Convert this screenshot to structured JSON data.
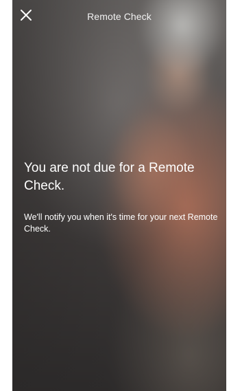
{
  "header": {
    "title": "Remote Check",
    "close_icon": "close-icon"
  },
  "message": {
    "headline": "You are not due for a Remote Check.",
    "body": "We'll notify you when it's time for your next Remote Check."
  },
  "colors": {
    "text": "#ffffff",
    "title_text": "#f2f2f2"
  }
}
